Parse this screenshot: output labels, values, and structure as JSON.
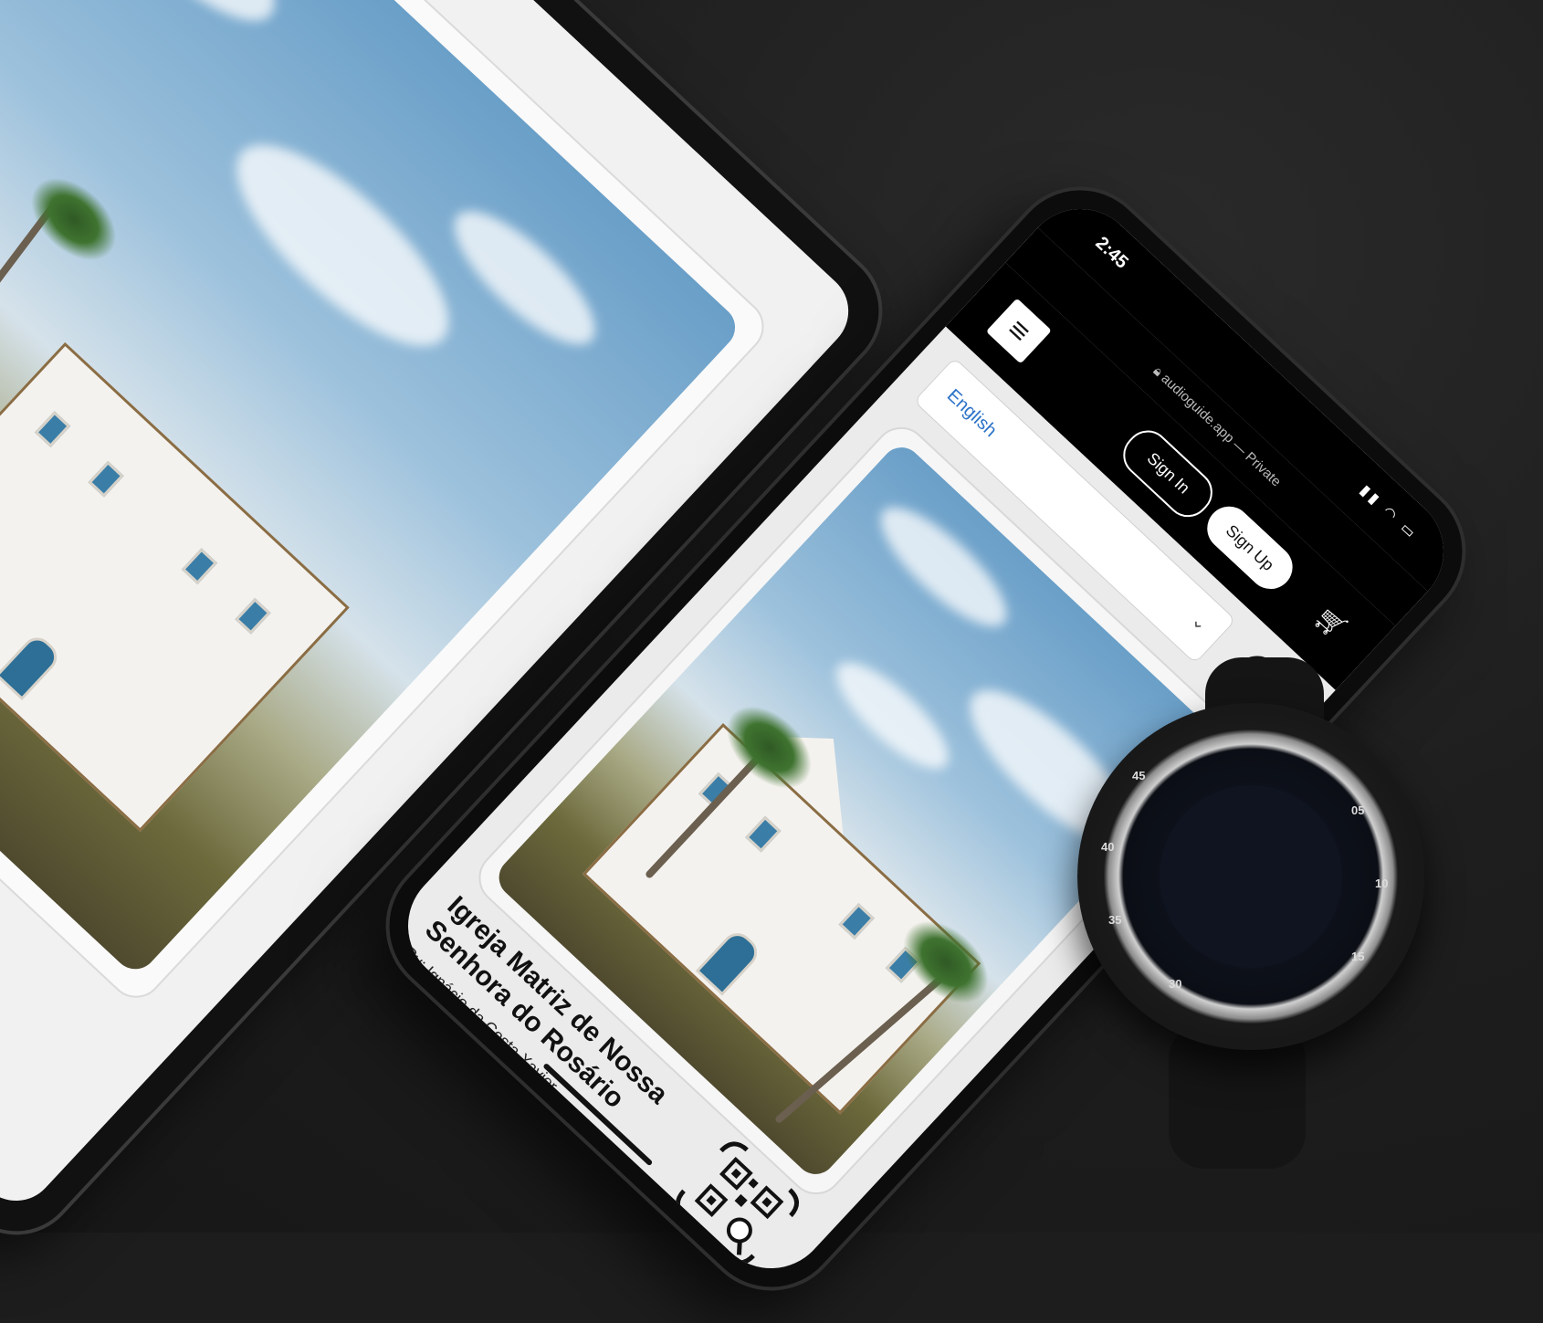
{
  "statusbar": {
    "time": "2:45",
    "icons": "▮▮ ◠ ▭"
  },
  "browser": {
    "url": "audioguide.app — Private"
  },
  "nav": {
    "menu_icon": "menu-icon",
    "sign_in": "Sign In",
    "sign_up": "Sign Up",
    "cart_icon": "cart-icon"
  },
  "language": {
    "selected": "English",
    "chevron": "⌄"
  },
  "tour": {
    "title": "Igreja Matriz de Nossa Senhora do Rosário",
    "byline": "By: Ignácio da Costa Xavier",
    "scan_label": "Scan next"
  },
  "watch": {
    "bezel": [
      "45",
      "05",
      "10",
      "15",
      "30",
      "35",
      "40"
    ]
  },
  "colors": {
    "link_blue": "#2b72c8",
    "bar_black": "#000000",
    "screen_bg": "#ebebeb"
  }
}
